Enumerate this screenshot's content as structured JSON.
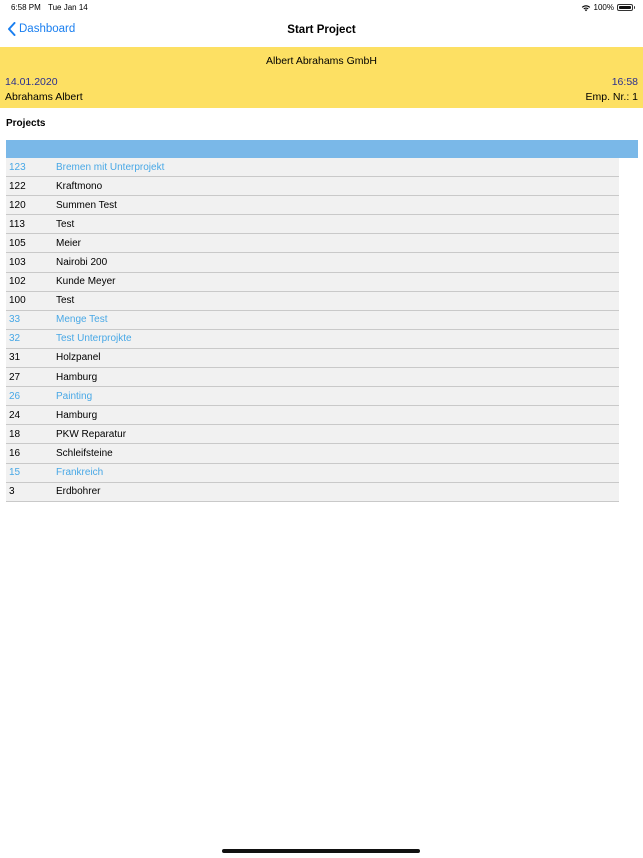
{
  "status_bar": {
    "time": "6:58 PM",
    "date": "Tue Jan 14",
    "battery": "100%"
  },
  "nav": {
    "back_label": "Dashboard",
    "title": "Start Project"
  },
  "header": {
    "company": "Albert Abrahams GmbH",
    "date": "14.01.2020",
    "time": "16:58",
    "employee": "Abrahams Albert",
    "emp_label": "Emp. Nr.:  1"
  },
  "section_title": "Projects",
  "colors": {
    "header_band": "#fde063",
    "table_header": "#7ab8e8",
    "link_blue": "#1a7ff0",
    "subproject_blue": "#48a8e6"
  },
  "projects": [
    {
      "id": "123",
      "name": "Bremen mit Unterprojekt",
      "sub": true
    },
    {
      "id": "122",
      "name": "Kraftmono",
      "sub": false
    },
    {
      "id": "120",
      "name": "Summen Test",
      "sub": false
    },
    {
      "id": "113",
      "name": "Test",
      "sub": false
    },
    {
      "id": "105",
      "name": "Meier",
      "sub": false
    },
    {
      "id": "103",
      "name": "Nairobi 200",
      "sub": false
    },
    {
      "id": "102",
      "name": "Kunde Meyer",
      "sub": false
    },
    {
      "id": "100",
      "name": "Test",
      "sub": false
    },
    {
      "id": "33",
      "name": "Menge Test",
      "sub": true
    },
    {
      "id": "32",
      "name": "Test Unterprojkte",
      "sub": true
    },
    {
      "id": "31",
      "name": "Holzpanel",
      "sub": false
    },
    {
      "id": "27",
      "name": "Hamburg",
      "sub": false
    },
    {
      "id": "26",
      "name": "Painting",
      "sub": true
    },
    {
      "id": "24",
      "name": "Hamburg",
      "sub": false
    },
    {
      "id": "18",
      "name": "PKW Reparatur",
      "sub": false
    },
    {
      "id": "16",
      "name": "Schleifsteine",
      "sub": false
    },
    {
      "id": "15",
      "name": "Frankreich",
      "sub": true
    },
    {
      "id": "3",
      "name": "Erdbohrer",
      "sub": false
    }
  ]
}
